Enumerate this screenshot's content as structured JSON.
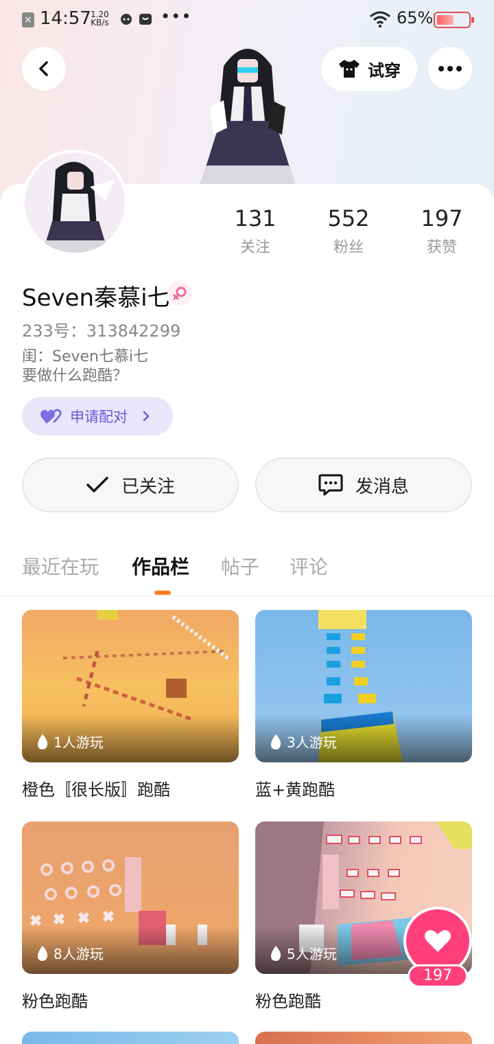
{
  "status_bar": {
    "time": "14:57",
    "net_speed_value": "1.20",
    "net_speed_unit": "KB/s",
    "more": "•••",
    "battery": "65%"
  },
  "header": {
    "tryon_label": "试穿"
  },
  "profile": {
    "stats": [
      {
        "value": "131",
        "label": "关注"
      },
      {
        "value": "552",
        "label": "粉丝"
      },
      {
        "value": "197",
        "label": "获赞"
      }
    ],
    "username": "Seven秦慕i七",
    "uid": "233号：313842299",
    "bio_line1": "闺：Seven七慕i七",
    "bio_line2": "要做什么跑酷？",
    "pair_label": "申请配对",
    "follow_label": "已关注",
    "message_label": "发消息"
  },
  "tabs": [
    {
      "label": "最近在玩"
    },
    {
      "label": "作品栏"
    },
    {
      "label": "帖子"
    },
    {
      "label": "评论"
    }
  ],
  "works": [
    {
      "plays": "1人游玩",
      "title": "橙色〚很长版〛跑酷"
    },
    {
      "plays": "3人游玩",
      "title": "蓝+黄跑酷"
    },
    {
      "plays": "8人游玩",
      "title": "粉色跑酷"
    },
    {
      "plays": "5人游玩",
      "title": "粉色跑酷"
    }
  ],
  "like_count": "197",
  "colors": {
    "accent_orange": "#ff7a1a",
    "like_pink": "#ff3f7c",
    "pair_purple": "#6a5bd6"
  }
}
